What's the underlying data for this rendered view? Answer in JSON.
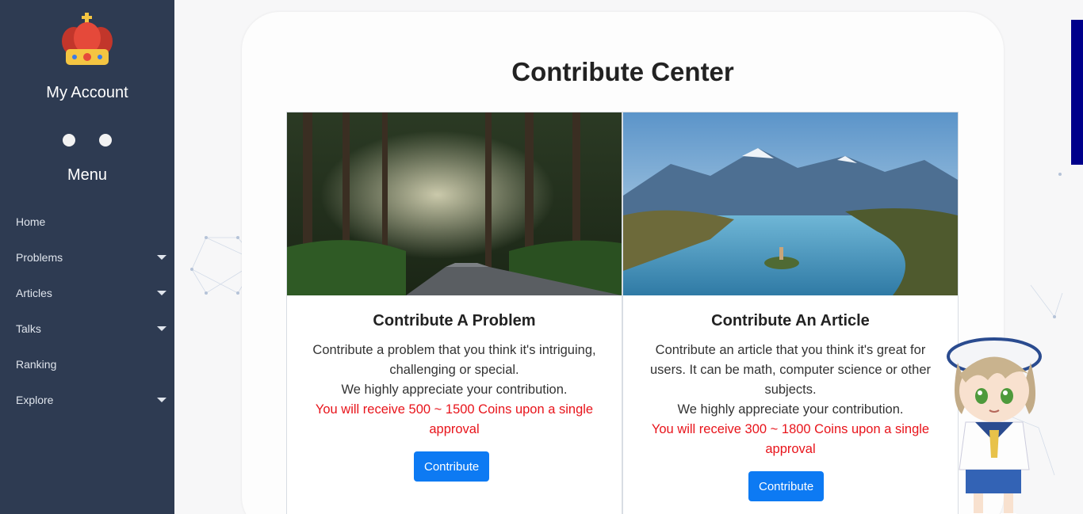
{
  "sidebar": {
    "account_title": "My Account",
    "menu_title": "Menu",
    "items": [
      {
        "label": "Home",
        "has_submenu": false
      },
      {
        "label": "Problems",
        "has_submenu": true
      },
      {
        "label": "Articles",
        "has_submenu": true
      },
      {
        "label": "Talks",
        "has_submenu": true
      },
      {
        "label": "Ranking",
        "has_submenu": false
      },
      {
        "label": "Explore",
        "has_submenu": true
      }
    ],
    "background_color": "#2e3b52"
  },
  "main": {
    "title": "Contribute Center",
    "cards": [
      {
        "image": "forest-road-image",
        "title": "Contribute A Problem",
        "description_1": "Contribute a problem that you think it's intriguing, challenging or special.",
        "description_2": "We highly appreciate your contribution.",
        "reward": "You will receive 500 ~ 1500 Coins upon a single approval",
        "button_label": "Contribute"
      },
      {
        "image": "mountain-lake-image",
        "title": "Contribute An Article",
        "description_1": "Contribute an article that you think it's great for users. It can be math, computer science or other subjects.",
        "description_2": "We highly appreciate your contribution.",
        "reward": "You will receive 300 ~ 1800 Coins upon a single approval",
        "button_label": "Contribute"
      }
    ]
  },
  "colors": {
    "accent_button": "#0d7af3",
    "reward_text": "#e8141b",
    "right_strip": "#00008b"
  }
}
